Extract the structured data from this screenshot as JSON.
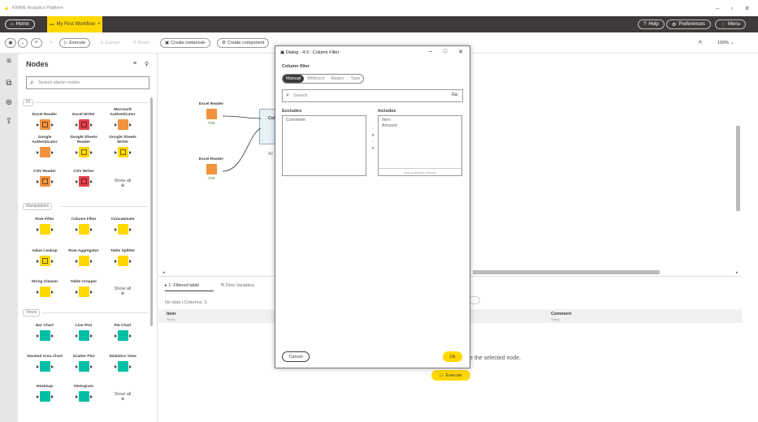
{
  "app": {
    "title": "KNIME Analytics Platform"
  },
  "tabs": {
    "home": "Home",
    "workflow": "My First Workflow",
    "help": "Help",
    "preferences": "Preferences",
    "menu": "Menu"
  },
  "toolbar": {
    "execute": "Execute",
    "cancel": "Cancel",
    "reset": "Reset",
    "create_metanode": "Create metanode",
    "create_component": "Create component",
    "zoom": "100%"
  },
  "node_panel": {
    "title": "Nodes",
    "search_placeholder": "Search starter nodes",
    "categories": [
      {
        "label": "IO",
        "nodes": [
          "Excel Reader",
          "Excel Writer",
          "Microsoft Authenticator",
          "Google Authenticator",
          "Google Sheets Reader",
          "Google Sheets Writer",
          "CSV Reader",
          "CSV Writer"
        ],
        "show_all": "Show all"
      },
      {
        "label": "Manipulation",
        "nodes": [
          "Row Filter",
          "Column Filter",
          "Concatenate",
          "Value Lookup",
          "Row Aggregator",
          "Table Splitter",
          "String Cleaner",
          "Table Cropper"
        ],
        "show_all": "Show all"
      },
      {
        "label": "Views",
        "nodes": [
          "Bar Chart",
          "Line Plot",
          "Pie Chart",
          "Stacked Area Chart",
          "Scatter Plot",
          "Statistics View",
          "Heatmap",
          "Histogram"
        ],
        "show_all": "Show all"
      }
    ]
  },
  "canvas": {
    "nodes": [
      "Excel Reader",
      "Excel Reader"
    ],
    "partial_labels": [
      "Col",
      "All"
    ]
  },
  "bottom_panel": {
    "tab_output": "1: Filtered table",
    "tab_flow": "Flow Variables",
    "status": "No data",
    "columns_count": "Columns: 3",
    "col1": "Item",
    "col1_type": "String",
    "col2": "Comment",
    "col2_type": "String",
    "hint": "e the selected node.",
    "execute": "Execute"
  },
  "dialog": {
    "title": "Dialog - 4:3 - Column Filter",
    "section": "Column filter",
    "modes": [
      "Manual",
      "Wildcard",
      "Regex",
      "Type"
    ],
    "active_mode": "Manual",
    "search_placeholder": "Search",
    "case_toggle": "Aa",
    "excludes_label": "Excludes",
    "includes_label": "Includes",
    "excludes": [
      "Comment"
    ],
    "includes": [
      "Item",
      "Amount"
    ],
    "any_unknown": "Any unknown column",
    "cancel": "Cancel",
    "ok": "Ok"
  },
  "colors": {
    "accent": "#ffd800",
    "dark": "#3e3a39",
    "orange": "#f2923c",
    "red": "#e3414a",
    "yellow": "#ffd800",
    "teal": "#00bfa5"
  }
}
